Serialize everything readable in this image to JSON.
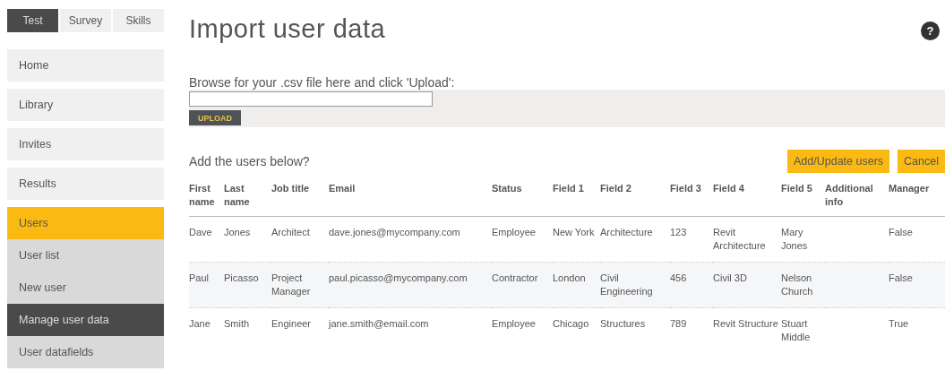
{
  "mode_tabs": [
    {
      "label": "Test",
      "selected": true
    },
    {
      "label": "Survey",
      "selected": false
    },
    {
      "label": "Skills",
      "selected": false
    }
  ],
  "sidebar": {
    "items": [
      {
        "label": "Home",
        "selected": false
      },
      {
        "label": "Library",
        "selected": false
      },
      {
        "label": "Invites",
        "selected": false
      },
      {
        "label": "Results",
        "selected": false
      },
      {
        "label": "Users",
        "selected": true,
        "children": [
          {
            "label": "User list",
            "selected": false
          },
          {
            "label": "New user",
            "selected": false
          },
          {
            "label": "Manage user data",
            "selected": true
          },
          {
            "label": "User datafields",
            "selected": false
          }
        ]
      }
    ]
  },
  "page": {
    "title": "Import user data",
    "help": "?"
  },
  "upload": {
    "label": "Browse for your .csv file here and click 'Upload':",
    "button": "UPLOAD"
  },
  "import": {
    "prompt": "Add the users below?",
    "buttons": [
      "Add/Update users",
      "Cancel"
    ]
  },
  "table": {
    "columns": [
      "First name",
      "Last name",
      "Job title",
      "Email",
      "Status",
      "Field 1",
      "Field 2",
      "Field 3",
      "Field 4",
      "Field 5",
      "Additional info",
      "Manager"
    ],
    "rows": [
      [
        "Dave",
        "Jones",
        "Architect",
        "dave.jones@mycompany.com",
        "Employee",
        "New York",
        "Architecture",
        "123",
        "Revit Architecture",
        "Mary Jones",
        "",
        "False"
      ],
      [
        "Paul",
        "Picasso",
        "Project Manager",
        "paul.picasso@mycompany.com",
        "Contractor",
        "London",
        "Civil Engineering",
        "456",
        "Civil 3D",
        "Nelson Church",
        "",
        "False"
      ],
      [
        "Jane",
        "Smith",
        "Engineer",
        "jane.smith@email.com",
        "Employee",
        "Chicago",
        "Structures",
        "789",
        "Revit Structure",
        "Stuart Middle",
        "",
        "True"
      ]
    ]
  }
}
